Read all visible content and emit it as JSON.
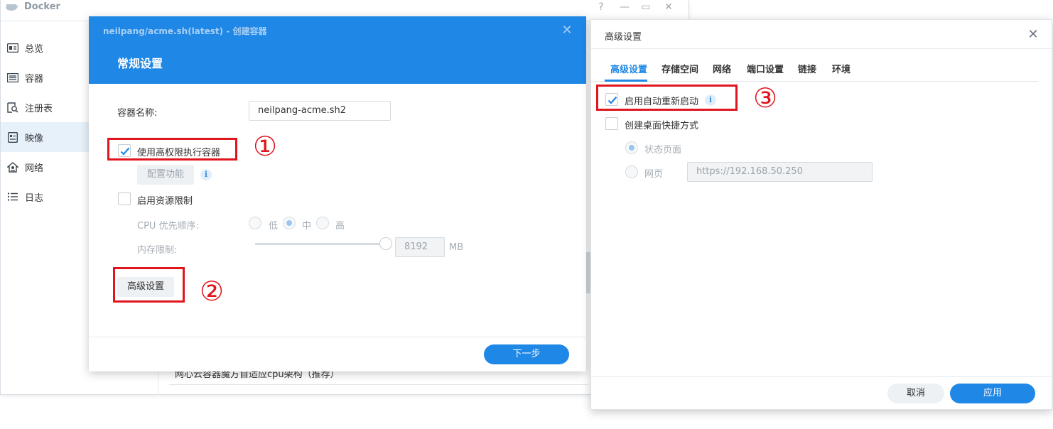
{
  "docker": {
    "title": "Docker",
    "controls": {
      "help": "?",
      "minimize": "—",
      "maximize": "▭",
      "close": "✕"
    },
    "sidebar": [
      {
        "label": "总览",
        "icon": "overview-icon"
      },
      {
        "label": "容器",
        "icon": "container-icon"
      },
      {
        "label": "注册表",
        "icon": "registry-icon"
      },
      {
        "label": "映像",
        "icon": "image-icon"
      },
      {
        "label": "网络",
        "icon": "network-icon"
      },
      {
        "label": "日志",
        "icon": "log-icon"
      }
    ],
    "active_sidebar_index": 3,
    "behind_row_text": "网心云容器魔方自适应cpu架构（推荐）"
  },
  "create_dialog": {
    "subtitle": "neilpang/acme.sh(latest) - 创建容器",
    "title": "常规设置",
    "close": "✕",
    "container_name_label": "容器名称:",
    "container_name_value": "neilpang-acme.sh2",
    "privileged_label": "使用高权限执行容器",
    "privileged_checked": true,
    "config_button": "配置功能",
    "info": "i",
    "resource_limit_label": "启用资源限制",
    "resource_limit_checked": false,
    "cpu_priority_label": "CPU 优先顺序:",
    "cpu_options": [
      "低",
      "中",
      "高"
    ],
    "cpu_selected": "中",
    "memory_label": "内存限制:",
    "memory_value": "8192",
    "memory_unit": "MB",
    "advanced_button": "高级设置",
    "next_button": "下一步"
  },
  "advanced_dialog": {
    "title": "高级设置",
    "close": "✕",
    "tabs": [
      "高级设置",
      "存储空间",
      "网络",
      "端口设置",
      "链接",
      "环境"
    ],
    "active_tab": "高级设置",
    "auto_restart_label": "启用自动重新启动",
    "auto_restart_checked": true,
    "info": "i",
    "desktop_shortcut_label": "创建桌面快捷方式",
    "desktop_shortcut_checked": false,
    "status_page_label": "状态页面",
    "webpage_label": "网页",
    "url_placeholder": "https://192.168.50.250",
    "cancel_button": "取消",
    "apply_button": "应用"
  },
  "annotations": {
    "one": "①",
    "two": "②",
    "three": "③",
    "color": "#e0151e"
  },
  "colors": {
    "accent": "#1f87e5",
    "annotation_red": "#e0151e",
    "active_sidebar": "#e7f1fa"
  }
}
